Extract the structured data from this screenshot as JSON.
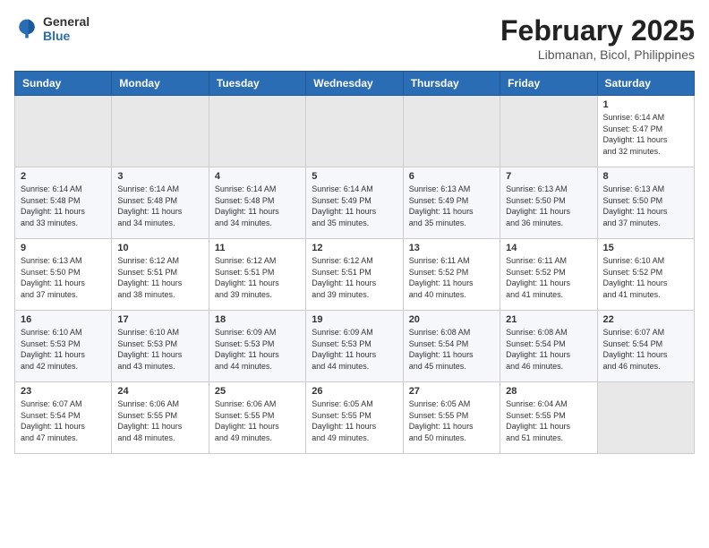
{
  "header": {
    "logo_general": "General",
    "logo_blue": "Blue",
    "month_title": "February 2025",
    "location": "Libmanan, Bicol, Philippines"
  },
  "weekdays": [
    "Sunday",
    "Monday",
    "Tuesday",
    "Wednesday",
    "Thursday",
    "Friday",
    "Saturday"
  ],
  "weeks": [
    [
      {
        "day": "",
        "info": ""
      },
      {
        "day": "",
        "info": ""
      },
      {
        "day": "",
        "info": ""
      },
      {
        "day": "",
        "info": ""
      },
      {
        "day": "",
        "info": ""
      },
      {
        "day": "",
        "info": ""
      },
      {
        "day": "1",
        "info": "Sunrise: 6:14 AM\nSunset: 5:47 PM\nDaylight: 11 hours\nand 32 minutes."
      }
    ],
    [
      {
        "day": "2",
        "info": "Sunrise: 6:14 AM\nSunset: 5:48 PM\nDaylight: 11 hours\nand 33 minutes."
      },
      {
        "day": "3",
        "info": "Sunrise: 6:14 AM\nSunset: 5:48 PM\nDaylight: 11 hours\nand 34 minutes."
      },
      {
        "day": "4",
        "info": "Sunrise: 6:14 AM\nSunset: 5:48 PM\nDaylight: 11 hours\nand 34 minutes."
      },
      {
        "day": "5",
        "info": "Sunrise: 6:14 AM\nSunset: 5:49 PM\nDaylight: 11 hours\nand 35 minutes."
      },
      {
        "day": "6",
        "info": "Sunrise: 6:13 AM\nSunset: 5:49 PM\nDaylight: 11 hours\nand 35 minutes."
      },
      {
        "day": "7",
        "info": "Sunrise: 6:13 AM\nSunset: 5:50 PM\nDaylight: 11 hours\nand 36 minutes."
      },
      {
        "day": "8",
        "info": "Sunrise: 6:13 AM\nSunset: 5:50 PM\nDaylight: 11 hours\nand 37 minutes."
      }
    ],
    [
      {
        "day": "9",
        "info": "Sunrise: 6:13 AM\nSunset: 5:50 PM\nDaylight: 11 hours\nand 37 minutes."
      },
      {
        "day": "10",
        "info": "Sunrise: 6:12 AM\nSunset: 5:51 PM\nDaylight: 11 hours\nand 38 minutes."
      },
      {
        "day": "11",
        "info": "Sunrise: 6:12 AM\nSunset: 5:51 PM\nDaylight: 11 hours\nand 39 minutes."
      },
      {
        "day": "12",
        "info": "Sunrise: 6:12 AM\nSunset: 5:51 PM\nDaylight: 11 hours\nand 39 minutes."
      },
      {
        "day": "13",
        "info": "Sunrise: 6:11 AM\nSunset: 5:52 PM\nDaylight: 11 hours\nand 40 minutes."
      },
      {
        "day": "14",
        "info": "Sunrise: 6:11 AM\nSunset: 5:52 PM\nDaylight: 11 hours\nand 41 minutes."
      },
      {
        "day": "15",
        "info": "Sunrise: 6:10 AM\nSunset: 5:52 PM\nDaylight: 11 hours\nand 41 minutes."
      }
    ],
    [
      {
        "day": "16",
        "info": "Sunrise: 6:10 AM\nSunset: 5:53 PM\nDaylight: 11 hours\nand 42 minutes."
      },
      {
        "day": "17",
        "info": "Sunrise: 6:10 AM\nSunset: 5:53 PM\nDaylight: 11 hours\nand 43 minutes."
      },
      {
        "day": "18",
        "info": "Sunrise: 6:09 AM\nSunset: 5:53 PM\nDaylight: 11 hours\nand 44 minutes."
      },
      {
        "day": "19",
        "info": "Sunrise: 6:09 AM\nSunset: 5:53 PM\nDaylight: 11 hours\nand 44 minutes."
      },
      {
        "day": "20",
        "info": "Sunrise: 6:08 AM\nSunset: 5:54 PM\nDaylight: 11 hours\nand 45 minutes."
      },
      {
        "day": "21",
        "info": "Sunrise: 6:08 AM\nSunset: 5:54 PM\nDaylight: 11 hours\nand 46 minutes."
      },
      {
        "day": "22",
        "info": "Sunrise: 6:07 AM\nSunset: 5:54 PM\nDaylight: 11 hours\nand 46 minutes."
      }
    ],
    [
      {
        "day": "23",
        "info": "Sunrise: 6:07 AM\nSunset: 5:54 PM\nDaylight: 11 hours\nand 47 minutes."
      },
      {
        "day": "24",
        "info": "Sunrise: 6:06 AM\nSunset: 5:55 PM\nDaylight: 11 hours\nand 48 minutes."
      },
      {
        "day": "25",
        "info": "Sunrise: 6:06 AM\nSunset: 5:55 PM\nDaylight: 11 hours\nand 49 minutes."
      },
      {
        "day": "26",
        "info": "Sunrise: 6:05 AM\nSunset: 5:55 PM\nDaylight: 11 hours\nand 49 minutes."
      },
      {
        "day": "27",
        "info": "Sunrise: 6:05 AM\nSunset: 5:55 PM\nDaylight: 11 hours\nand 50 minutes."
      },
      {
        "day": "28",
        "info": "Sunrise: 6:04 AM\nSunset: 5:55 PM\nDaylight: 11 hours\nand 51 minutes."
      },
      {
        "day": "",
        "info": ""
      }
    ]
  ]
}
